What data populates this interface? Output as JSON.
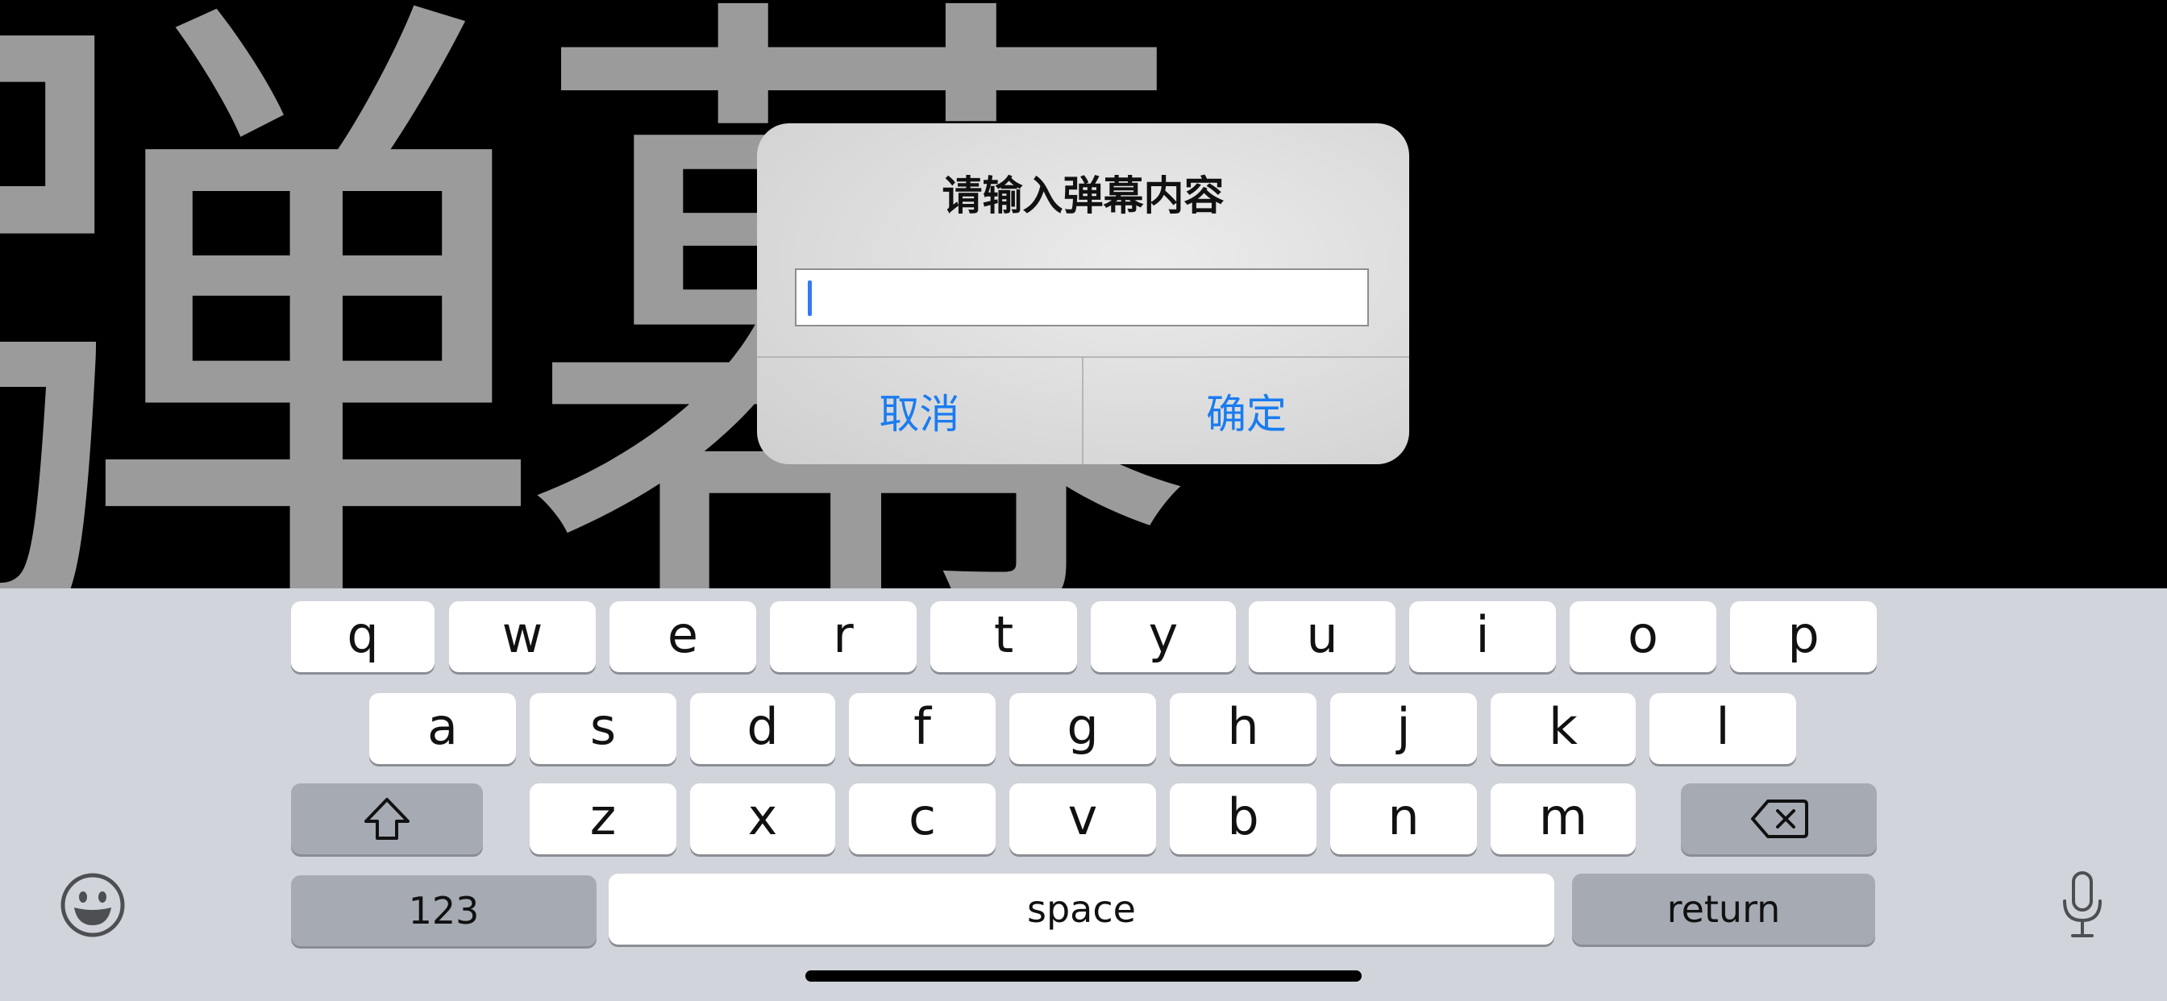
{
  "background": {
    "video_text": "弹幕"
  },
  "alert": {
    "title": "请输入弹幕内容",
    "input_value": "",
    "cancel_label": "取消",
    "confirm_label": "确定"
  },
  "keyboard": {
    "row1": [
      "q",
      "w",
      "e",
      "r",
      "t",
      "y",
      "u",
      "i",
      "o",
      "p"
    ],
    "row2": [
      "a",
      "s",
      "d",
      "f",
      "g",
      "h",
      "j",
      "k",
      "l"
    ],
    "row3": [
      "z",
      "x",
      "c",
      "v",
      "b",
      "n",
      "m"
    ],
    "shift_icon": "shift-icon",
    "delete_icon": "delete-icon",
    "numbers_label": "123",
    "space_label": "space",
    "return_label": "return",
    "emoji_icon": "emoji-icon",
    "mic_icon": "microphone-icon"
  },
  "colors": {
    "accent": "#1a7cf0",
    "keyboard_bg": "#d1d4da",
    "key_bg": "#ffffff",
    "special_key_bg": "#a6aab3"
  }
}
